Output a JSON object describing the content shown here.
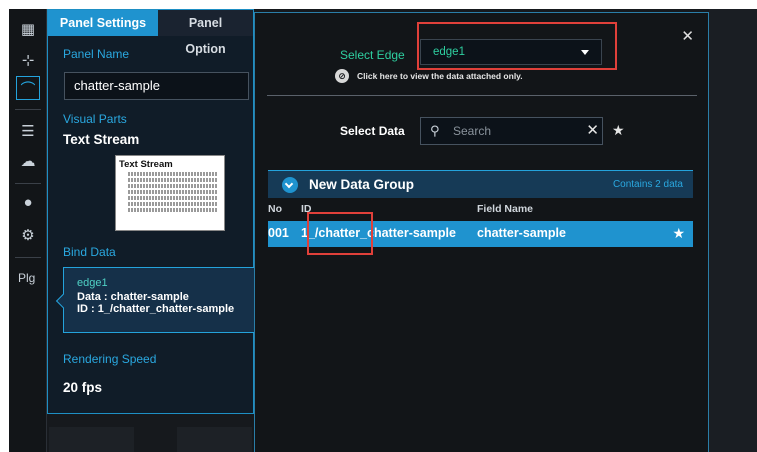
{
  "rail": {
    "items": [
      "dashboard",
      "add",
      "panel",
      "list",
      "upload",
      "user",
      "gear"
    ],
    "plugin_label": "Plg"
  },
  "settings": {
    "tabs": [
      "Panel Settings",
      "Panel Option"
    ],
    "panel_name_label": "Panel Name",
    "panel_name_value": "chatter-sample",
    "visual_parts_label": "Visual Parts",
    "visual_parts_value": "Text Stream",
    "thumb_title": "Text Stream",
    "bind_data_label": "Bind Data",
    "bind": {
      "edge": "edge1",
      "data_line": "Data : chatter-sample",
      "id_line": "ID : 1_/chatter_chatter-sample"
    },
    "rendering_speed_label": "Rendering Speed",
    "rendering_speed_value": "20 fps"
  },
  "dialog": {
    "select_edge_label": "Select Edge",
    "edge_value": "edge1",
    "attached_only_text": "Click here to view the data attached only.",
    "select_data_label": "Select Data",
    "search_placeholder": "Search",
    "group": {
      "name": "New Data Group",
      "count_text": "Contains 2 data"
    },
    "columns": [
      "No",
      "ID",
      "Field Name"
    ],
    "rows": [
      {
        "no": "001",
        "id": "1_/chatter_chatter-sample",
        "field": "chatter-sample"
      }
    ]
  },
  "colors": {
    "accent": "#1f93cf",
    "edge_text": "#2ecfa0",
    "highlight_box": "#e0403a"
  }
}
